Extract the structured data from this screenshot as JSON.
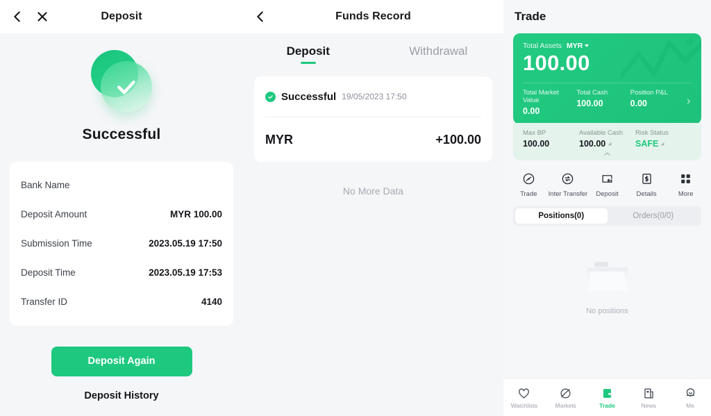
{
  "colors": {
    "brand_green": "#1ec87e",
    "card_green_start": "#22ca82",
    "card_green_end": "#1ec27a",
    "sub_card_mint": "#e4f4ec",
    "page_bg": "#f5f6f8",
    "text_primary": "#15161a",
    "text_muted": "#9a9ea6"
  },
  "deposit_result": {
    "navbar": {
      "title": "Deposit",
      "back_icon": "chevron-left-icon",
      "close_icon": "close-icon"
    },
    "hero": {
      "icon": "success-check-icon",
      "title": "Successful"
    },
    "details": [
      {
        "label": "Bank Name",
        "value": ""
      },
      {
        "label": "Deposit Amount",
        "value": "MYR 100.00"
      },
      {
        "label": "Submission Time",
        "value": "2023.05.19 17:50"
      },
      {
        "label": "Deposit Time",
        "value": "2023.05.19 17:53"
      },
      {
        "label": "Transfer ID",
        "value": "4140"
      }
    ],
    "primary_button": "Deposit Again",
    "secondary_link": "Deposit History"
  },
  "funds_record": {
    "navbar": {
      "title": "Funds Record",
      "back_icon": "chevron-left-icon"
    },
    "tabs": [
      {
        "label": "Deposit",
        "active": true
      },
      {
        "label": "Withdrawal",
        "active": false
      }
    ],
    "record": {
      "status_icon": "check-circle-icon",
      "status": "Successful",
      "timestamp": "19/05/2023 17:50",
      "currency": "MYR",
      "amount": "+100.00"
    },
    "footer_text": "No More Data"
  },
  "trade": {
    "title": "Trade",
    "asset_card": {
      "total_label": "Total Assets",
      "currency": "MYR",
      "currency_caret": "chevron-down-icon",
      "total_value": "100.00",
      "chevron_icon": "chevron-right-icon",
      "stats": [
        {
          "label": "Total Market Value",
          "value": "0.00"
        },
        {
          "label": "Total Cash",
          "value": "100.00"
        },
        {
          "label": "Position P&L",
          "value": "0.00"
        }
      ]
    },
    "sub_card": {
      "stats": [
        {
          "label": "Max BP",
          "value": "100.00",
          "info": false,
          "safe": false
        },
        {
          "label": "Available Cash",
          "value": "100.00",
          "info": true,
          "safe": false
        },
        {
          "label": "Risk Status",
          "value": "SAFE",
          "info": true,
          "safe": true
        }
      ],
      "collapse_icon": "chevron-up-icon"
    },
    "actions": [
      {
        "label": "Trade",
        "icon": "trade-circle-icon"
      },
      {
        "label": "Inter Transfer",
        "icon": "transfer-circle-icon"
      },
      {
        "label": "Deposit",
        "icon": "deposit-card-icon"
      },
      {
        "label": "Details",
        "icon": "details-document-icon"
      },
      {
        "label": "More",
        "icon": "grid-more-icon"
      }
    ],
    "segments": [
      {
        "label": "Positions(0)",
        "active": true
      },
      {
        "label": "Orders(0/0)",
        "active": false
      }
    ],
    "empty": {
      "icon": "empty-folder-icon",
      "label": "No positions"
    },
    "bottom_nav": [
      {
        "label": "Watchlists",
        "icon": "heart-icon",
        "active": false
      },
      {
        "label": "Markets",
        "icon": "planet-icon",
        "active": false
      },
      {
        "label": "Trade",
        "icon": "trade-square-icon",
        "active": true
      },
      {
        "label": "News",
        "icon": "news-icon",
        "active": false
      },
      {
        "label": "Me",
        "icon": "person-icon",
        "active": false
      }
    ]
  }
}
